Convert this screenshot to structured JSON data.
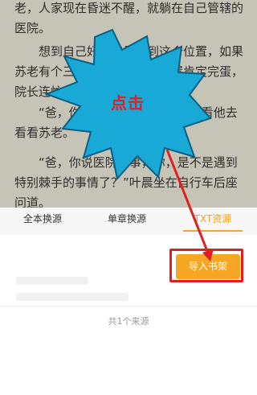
{
  "reader": {
    "para1": "老，人家现在昏迷不醒，就躺在自己管辖的医院。",
    "para2": "想到自己好不容易爬到这个位置，如果苏老有个三长两短，那他的位置肯定完蛋，院长连忙走。",
    "para3": "“爸，你说医院的事，我想过去看他去看看苏老。",
    "para4": "“爸，你说医院的事，你，是不是遇到特别棘手的事情了？”叶晨坐在自行车后座问道。"
  },
  "annotation": {
    "label": "点击",
    "burst_color": "#18a9d6",
    "arrow_color": "#e02020"
  },
  "sheet": {
    "tabs": [
      {
        "label": "全本换源"
      },
      {
        "label": "单章换源"
      },
      {
        "label": "TXT资源"
      }
    ],
    "active_tab": "TXT资源",
    "import_button": "导入书架",
    "source_count": "共1个来源",
    "accent_color": "#f5a623"
  }
}
